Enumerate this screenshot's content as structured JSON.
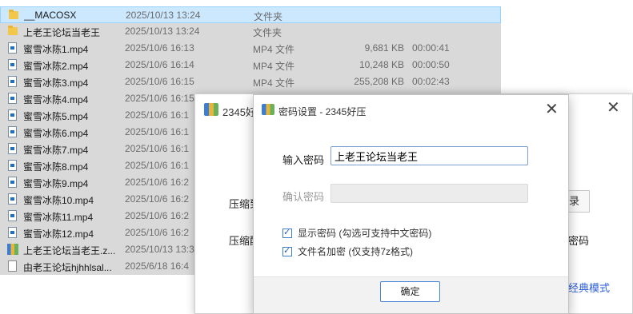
{
  "files": [
    {
      "icon": "folder",
      "name": "__MACOSX",
      "date": "2025/10/13 13:24",
      "type": "文件夹",
      "size": "",
      "duration": "",
      "state": "selected-active"
    },
    {
      "icon": "folder",
      "name": "上老王论坛当老王",
      "date": "2025/10/13 13:24",
      "type": "文件夹",
      "size": "",
      "duration": "",
      "state": "selected"
    },
    {
      "icon": "mp4",
      "name": "蜜雪冰陈1.mp4",
      "date": "2025/10/6 16:13",
      "type": "MP4 文件",
      "size": "9,681 KB",
      "duration": "00:00:41",
      "state": "selected"
    },
    {
      "icon": "mp4",
      "name": "蜜雪冰陈2.mp4",
      "date": "2025/10/6 16:14",
      "type": "MP4 文件",
      "size": "10,248 KB",
      "duration": "00:00:50",
      "state": "selected"
    },
    {
      "icon": "mp4",
      "name": "蜜雪冰陈3.mp4",
      "date": "2025/10/6 16:15",
      "type": "MP4 文件",
      "size": "255,208 KB",
      "duration": "00:02:43",
      "state": "selected"
    },
    {
      "icon": "mp4",
      "name": "蜜雪冰陈4.mp4",
      "date": "2025/10/6 16:15",
      "type": "",
      "size": "",
      "duration": "",
      "state": "selected"
    },
    {
      "icon": "mp4",
      "name": "蜜雪冰陈5.mp4",
      "date": "2025/10/6 16:1",
      "type": "",
      "size": "",
      "duration": "",
      "state": "selected"
    },
    {
      "icon": "mp4",
      "name": "蜜雪冰陈6.mp4",
      "date": "2025/10/6 16:1",
      "type": "",
      "size": "",
      "duration": "",
      "state": "selected"
    },
    {
      "icon": "mp4",
      "name": "蜜雪冰陈7.mp4",
      "date": "2025/10/6 16:1",
      "type": "",
      "size": "",
      "duration": "",
      "state": "selected"
    },
    {
      "icon": "mp4",
      "name": "蜜雪冰陈8.mp4",
      "date": "2025/10/6 16:1",
      "type": "",
      "size": "",
      "duration": "",
      "state": "selected"
    },
    {
      "icon": "mp4",
      "name": "蜜雪冰陈9.mp4",
      "date": "2025/10/6 16:2",
      "type": "",
      "size": "",
      "duration": "",
      "state": "selected"
    },
    {
      "icon": "mp4",
      "name": "蜜雪冰陈10.mp4",
      "date": "2025/10/6 16:2",
      "type": "",
      "size": "",
      "duration": "",
      "state": "selected"
    },
    {
      "icon": "mp4",
      "name": "蜜雪冰陈11.mp4",
      "date": "2025/10/6 16:2",
      "type": "",
      "size": "",
      "duration": "",
      "state": "selected"
    },
    {
      "icon": "mp4",
      "name": "蜜雪冰陈12.mp4",
      "date": "2025/10/6 16:2",
      "type": "",
      "size": "",
      "duration": "",
      "state": "selected"
    },
    {
      "icon": "zip",
      "name": "上老王论坛当老王.z...",
      "date": "2025/10/13 13:3",
      "type": "",
      "size": "",
      "duration": "",
      "state": "selected"
    },
    {
      "icon": "txt",
      "name": "由老王论坛hjhhlsal...",
      "date": "2025/6/18 16:4",
      "type": "",
      "size": "",
      "duration": "",
      "state": "selected"
    }
  ],
  "main_window": {
    "title": "2345好",
    "close": "✕",
    "label1": "压缩到",
    "label2": "压缩配",
    "btn_partial": "录",
    "text_partial": "密码",
    "link_partial": "经典模式"
  },
  "password_dialog": {
    "title": "密码设置 - 2345好压",
    "close": "✕",
    "password_label": "输入密码",
    "password_value": "上老王论坛当老王",
    "confirm_label": "确认密码",
    "confirm_value": "",
    "show_password": "显示密码 (勾选可支持中文密码)",
    "show_password_checked": true,
    "encrypt_names": "文件名加密 (仅支持7z格式)",
    "encrypt_names_checked": true,
    "ok_label": "确定"
  },
  "colors": {
    "selection_active": "#cce8ff",
    "selection_inactive": "#d9d9d9",
    "link": "#2a5bd7"
  }
}
